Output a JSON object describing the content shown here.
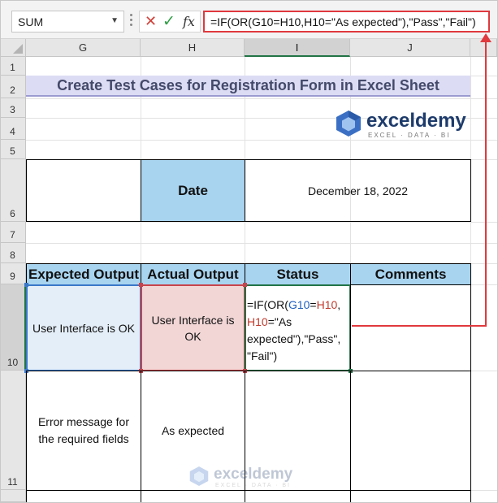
{
  "formula_bar": {
    "name_box": "SUM",
    "cancel_icon": "✕",
    "enter_icon": "✓",
    "fx_label": "fx",
    "formula": "=IF(OR(G10=H10,H10=\"As expected\"),\"Pass\",\"Fail\")"
  },
  "columns": [
    "G",
    "H",
    "I",
    "J"
  ],
  "rows": [
    "1",
    "2",
    "3",
    "4",
    "5",
    "6",
    "7",
    "8",
    "9",
    "10",
    "11"
  ],
  "title": "Create Test Cases for Registration Form in Excel Sheet",
  "logo": {
    "name": "exceldemy",
    "tagline": "EXCEL · DATA · BI"
  },
  "date_row": {
    "label": "Date",
    "value": "December 18, 2022"
  },
  "table": {
    "headers": [
      "Expected Output",
      "Actual Output",
      "Status",
      "Comments"
    ],
    "row10": {
      "expected": "User Interface is OK",
      "actual": "User Interface is OK",
      "formula_parts": [
        "=IF(OR(",
        "G10",
        "=",
        "H10",
        ",",
        "H10",
        "=\"As",
        "expected\"),\"Pass\",",
        "\"Fail\")"
      ],
      "comments": ""
    },
    "row11": {
      "expected": "Error message for the required fields",
      "actual": "As expected",
      "status": "",
      "comments": ""
    }
  },
  "colors": {
    "accent_green": "#217346",
    "arrow_red": "#e0393e",
    "header_blue": "#a8d4ef",
    "title_band": "#dcdcf4"
  }
}
